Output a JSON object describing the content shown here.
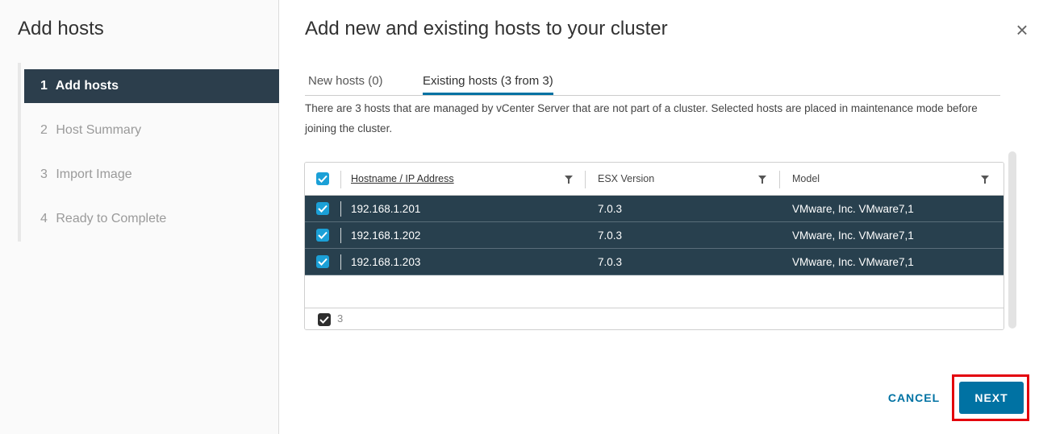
{
  "sidebar": {
    "title": "Add hosts",
    "steps": [
      {
        "num": "1",
        "label": "Add hosts"
      },
      {
        "num": "2",
        "label": "Host Summary"
      },
      {
        "num": "3",
        "label": "Import Image"
      },
      {
        "num": "4",
        "label": "Ready to Complete"
      }
    ]
  },
  "main": {
    "title": "Add new and existing hosts to your cluster",
    "close_icon": "×",
    "tabs": [
      {
        "label": "New hosts (0)"
      },
      {
        "label": "Existing hosts (3 from 3)"
      }
    ],
    "description": "There are 3 hosts that are managed by vCenter Server that are not part of a cluster. Selected hosts are placed in maintenance mode before joining the cluster."
  },
  "grid": {
    "columns": [
      "Hostname / IP Address",
      "ESX Version",
      "Model"
    ],
    "rows": [
      {
        "host": "192.168.1.201",
        "version": "7.0.3",
        "model": "VMware, Inc. VMware7,1"
      },
      {
        "host": "192.168.1.202",
        "version": "7.0.3",
        "model": "VMware, Inc. VMware7,1"
      },
      {
        "host": "192.168.1.203",
        "version": "7.0.3",
        "model": "VMware, Inc. VMware7,1"
      }
    ],
    "selected_count": "3"
  },
  "footer": {
    "cancel_label": "CANCEL",
    "next_label": "NEXT"
  },
  "colors": {
    "accent": "#0072a3",
    "row_selected": "#28404e",
    "checkbox": "#1ba0d7",
    "highlight": "#e3000b"
  }
}
